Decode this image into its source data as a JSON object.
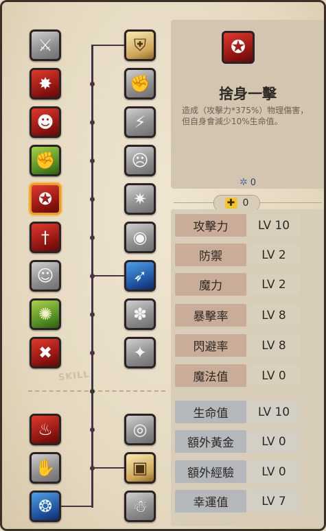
{
  "detail": {
    "title": "捨身一擊",
    "description": "造成（攻擊力*375%）物理傷害，但自身會減少10%生命值。",
    "icon": "reckless-strike-icon",
    "cost_value": "0"
  },
  "skill_points": {
    "value": "0"
  },
  "divider_label": "SKILL",
  "stats": [
    {
      "name": "攻擊力",
      "level": "LV 10",
      "group": "warm"
    },
    {
      "name": "防禦",
      "level": "LV 2",
      "group": "warm"
    },
    {
      "name": "魔力",
      "level": "LV 2",
      "group": "warm"
    },
    {
      "name": "暴擊率",
      "level": "LV 8",
      "group": "warm"
    },
    {
      "name": "閃避率",
      "level": "LV 8",
      "group": "warm"
    },
    {
      "name": "魔法值",
      "level": "LV 0",
      "group": "warm"
    },
    {
      "name": "生命值",
      "level": "LV 10",
      "group": "cool"
    },
    {
      "name": "額外黃金",
      "level": "LV 0",
      "group": "cool"
    },
    {
      "name": "額外經驗",
      "level": "LV 0",
      "group": "cool"
    },
    {
      "name": "幸運值",
      "level": "LV 7",
      "group": "cool"
    }
  ],
  "skill_tree": {
    "left": [
      {
        "icon": "slash-icon",
        "state": "locked"
      },
      {
        "icon": "power-burst-icon",
        "state": "unlocked"
      },
      {
        "icon": "rage-roar-icon",
        "state": "unlocked"
      },
      {
        "icon": "muscle-icon",
        "state": "unlocked"
      },
      {
        "icon": "reckless-strike-icon",
        "state": "selected"
      },
      {
        "icon": "dagger-icon",
        "state": "unlocked"
      },
      {
        "icon": "shadow-icon",
        "state": "locked"
      },
      {
        "icon": "nature-aura-icon",
        "state": "unlocked"
      },
      {
        "icon": "crossed-swords-icon",
        "state": "unlocked"
      },
      {
        "icon": "potion-cauldron-icon",
        "state": "unlocked"
      },
      {
        "icon": "hand-icon",
        "state": "locked"
      },
      {
        "icon": "spirit-icon",
        "state": "unlocked"
      }
    ],
    "right": [
      {
        "icon": "shield-icon",
        "state": "unlocked"
      },
      {
        "icon": "punch-icon",
        "state": "locked"
      },
      {
        "icon": "lightning-icon",
        "state": "locked"
      },
      {
        "icon": "war-cry-icon",
        "state": "locked"
      },
      {
        "icon": "whirlwind-icon",
        "state": "locked"
      },
      {
        "icon": "cracked-orb-icon",
        "state": "locked"
      },
      {
        "icon": "blade-dash-icon",
        "state": "unlocked"
      },
      {
        "icon": "spin-icon",
        "state": "locked"
      },
      {
        "icon": "sparkle-icon",
        "state": "locked"
      },
      {
        "icon": "eye-icon",
        "state": "locked"
      },
      {
        "icon": "treasure-chest-icon",
        "state": "unlocked"
      },
      {
        "icon": "ghost-icon",
        "state": "locked"
      }
    ]
  }
}
